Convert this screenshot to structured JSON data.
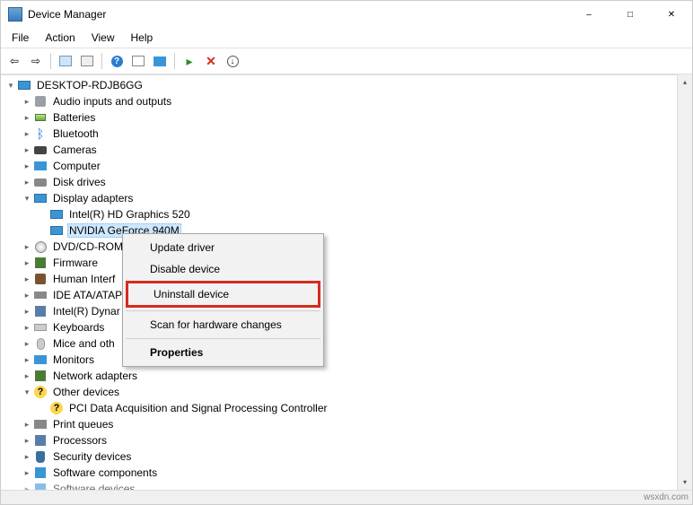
{
  "window": {
    "title": "Device Manager"
  },
  "menubar": [
    "File",
    "Action",
    "View",
    "Help"
  ],
  "root": "DESKTOP-RDJB6GG",
  "categories": [
    {
      "label": "Audio inputs and outputs",
      "icon": "audio"
    },
    {
      "label": "Batteries",
      "icon": "batt"
    },
    {
      "label": "Bluetooth",
      "icon": "bt"
    },
    {
      "label": "Cameras",
      "icon": "cam"
    },
    {
      "label": "Computer",
      "icon": "comp"
    },
    {
      "label": "Disk drives",
      "icon": "disk"
    },
    {
      "label": "Display adapters",
      "icon": "disp",
      "expanded": true,
      "children": [
        {
          "label": "Intel(R) HD Graphics 520"
        },
        {
          "label": "NVIDIA GeForce 940M",
          "selected": true
        }
      ]
    },
    {
      "label": "DVD/CD-ROM",
      "icon": "dvd",
      "truncated": true
    },
    {
      "label": "Firmware",
      "icon": "fw"
    },
    {
      "label": "Human Interf",
      "icon": "hid",
      "truncated": true
    },
    {
      "label": "IDE ATA/ATAP",
      "icon": "ide",
      "truncated": true
    },
    {
      "label": "Intel(R) Dynar",
      "icon": "proc",
      "truncated": true
    },
    {
      "label": "Keyboards",
      "icon": "kb"
    },
    {
      "label": "Mice and oth",
      "icon": "mouse",
      "truncated": true
    },
    {
      "label": "Monitors",
      "icon": "mon"
    },
    {
      "label": "Network adapters",
      "icon": "net"
    },
    {
      "label": "Other devices",
      "icon": "other",
      "expanded": true,
      "children": [
        {
          "label": "PCI Data Acquisition and Signal Processing Controller",
          "icon": "other-child"
        }
      ]
    },
    {
      "label": "Print queues",
      "icon": "print"
    },
    {
      "label": "Processors",
      "icon": "proc"
    },
    {
      "label": "Security devices",
      "icon": "sec"
    },
    {
      "label": "Software components",
      "icon": "soft"
    },
    {
      "label": "Software devices",
      "icon": "soft",
      "cut": true
    }
  ],
  "context_menu": {
    "items": [
      {
        "label": "Update driver"
      },
      {
        "label": "Disable device"
      },
      {
        "label": "Uninstall device",
        "highlighted": true
      },
      {
        "sep": true
      },
      {
        "label": "Scan for hardware changes"
      },
      {
        "sep": true
      },
      {
        "label": "Properties",
        "bold": true
      }
    ]
  },
  "watermark": "wsxdn.com"
}
